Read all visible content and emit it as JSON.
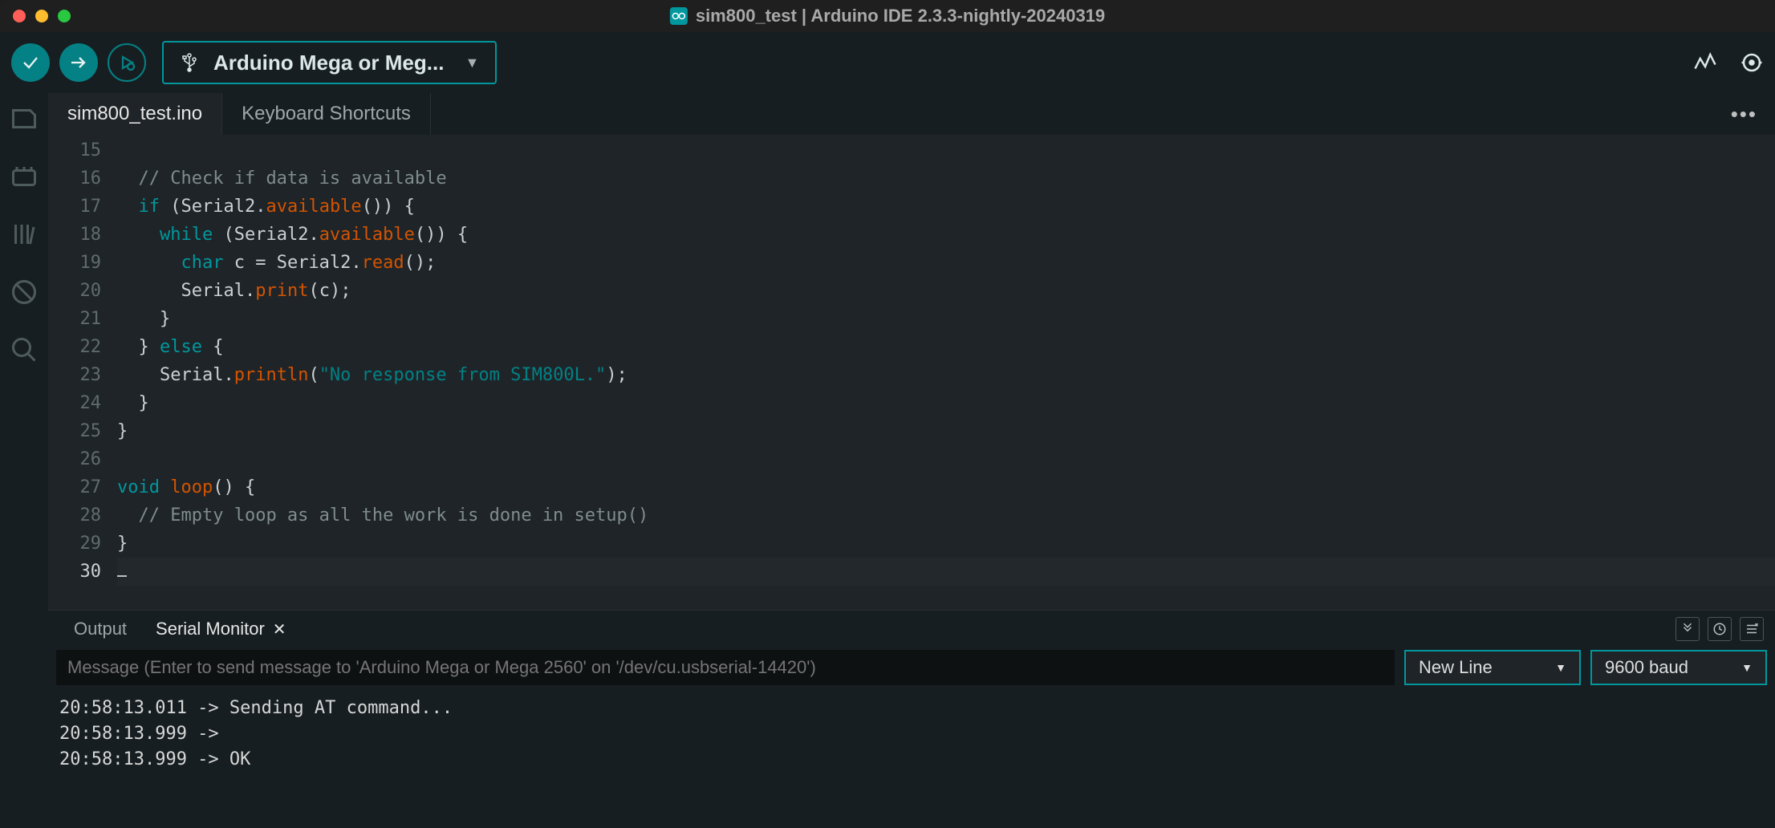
{
  "window": {
    "title": "sim800_test | Arduino IDE 2.3.3-nightly-20240319"
  },
  "toolbar": {
    "board_label": "Arduino Mega or Meg..."
  },
  "tabs": [
    {
      "label": "sim800_test.ino",
      "active": true
    },
    {
      "label": "Keyboard Shortcuts",
      "active": false
    }
  ],
  "editor": {
    "first_line": 15,
    "current_line": 30,
    "lines": [
      {
        "n": 15,
        "seg": [
          {
            "t": "",
            "c": ""
          }
        ],
        "indent": 1
      },
      {
        "n": 16,
        "seg": [
          {
            "t": "// Check if data is available",
            "c": "comment"
          }
        ],
        "indent": 1
      },
      {
        "n": 17,
        "seg": [
          {
            "t": "if",
            "c": "keyword"
          },
          {
            "t": " (",
            "c": "punct"
          },
          {
            "t": "Serial2",
            "c": "ident"
          },
          {
            "t": ".",
            "c": "punct"
          },
          {
            "t": "available",
            "c": "func"
          },
          {
            "t": "()) {",
            "c": "punct"
          }
        ],
        "indent": 1
      },
      {
        "n": 18,
        "seg": [
          {
            "t": "while",
            "c": "keyword"
          },
          {
            "t": " (",
            "c": "punct"
          },
          {
            "t": "Serial2",
            "c": "ident"
          },
          {
            "t": ".",
            "c": "punct"
          },
          {
            "t": "available",
            "c": "func"
          },
          {
            "t": "()) {",
            "c": "punct"
          }
        ],
        "indent": 2
      },
      {
        "n": 19,
        "seg": [
          {
            "t": "char",
            "c": "type"
          },
          {
            "t": " c = ",
            "c": "punct"
          },
          {
            "t": "Serial2",
            "c": "ident"
          },
          {
            "t": ".",
            "c": "punct"
          },
          {
            "t": "read",
            "c": "func"
          },
          {
            "t": "();",
            "c": "punct"
          }
        ],
        "indent": 3
      },
      {
        "n": 20,
        "seg": [
          {
            "t": "Serial",
            "c": "ident"
          },
          {
            "t": ".",
            "c": "punct"
          },
          {
            "t": "print",
            "c": "func"
          },
          {
            "t": "(c);",
            "c": "punct"
          }
        ],
        "indent": 3
      },
      {
        "n": 21,
        "seg": [
          {
            "t": "}",
            "c": "punct"
          }
        ],
        "indent": 2
      },
      {
        "n": 22,
        "seg": [
          {
            "t": "} ",
            "c": "punct"
          },
          {
            "t": "else",
            "c": "keyword"
          },
          {
            "t": " {",
            "c": "punct"
          }
        ],
        "indent": 1
      },
      {
        "n": 23,
        "seg": [
          {
            "t": "Serial",
            "c": "ident"
          },
          {
            "t": ".",
            "c": "punct"
          },
          {
            "t": "println",
            "c": "func"
          },
          {
            "t": "(",
            "c": "punct"
          },
          {
            "t": "\"No response from SIM800L.\"",
            "c": "string"
          },
          {
            "t": ");",
            "c": "punct"
          }
        ],
        "indent": 2
      },
      {
        "n": 24,
        "seg": [
          {
            "t": "}",
            "c": "punct"
          }
        ],
        "indent": 1
      },
      {
        "n": 25,
        "seg": [
          {
            "t": "}",
            "c": "punct"
          }
        ],
        "indent": 0
      },
      {
        "n": 26,
        "seg": [
          {
            "t": "",
            "c": ""
          }
        ],
        "indent": 0
      },
      {
        "n": 27,
        "seg": [
          {
            "t": "void",
            "c": "type"
          },
          {
            "t": " ",
            "c": "punct"
          },
          {
            "t": "loop",
            "c": "func"
          },
          {
            "t": "() {",
            "c": "punct"
          }
        ],
        "indent": 0
      },
      {
        "n": 28,
        "seg": [
          {
            "t": "// Empty loop as all the work is done in setup()",
            "c": "comment"
          }
        ],
        "indent": 1
      },
      {
        "n": 29,
        "seg": [
          {
            "t": "}",
            "c": "punct"
          }
        ],
        "indent": 0
      },
      {
        "n": 30,
        "seg": [
          {
            "t": "",
            "c": ""
          }
        ],
        "indent": 0
      }
    ]
  },
  "panel": {
    "tabs": {
      "output": "Output",
      "serial": "Serial Monitor"
    },
    "active": "serial",
    "message_placeholder": "Message (Enter to send message to 'Arduino Mega or Mega 2560' on '/dev/cu.usbserial-14420')",
    "line_ending": "New Line",
    "baud": "9600 baud",
    "output_lines": [
      "20:58:13.011 -> Sending AT command...",
      "20:58:13.999 -> ",
      "20:58:13.999 -> OK"
    ]
  }
}
